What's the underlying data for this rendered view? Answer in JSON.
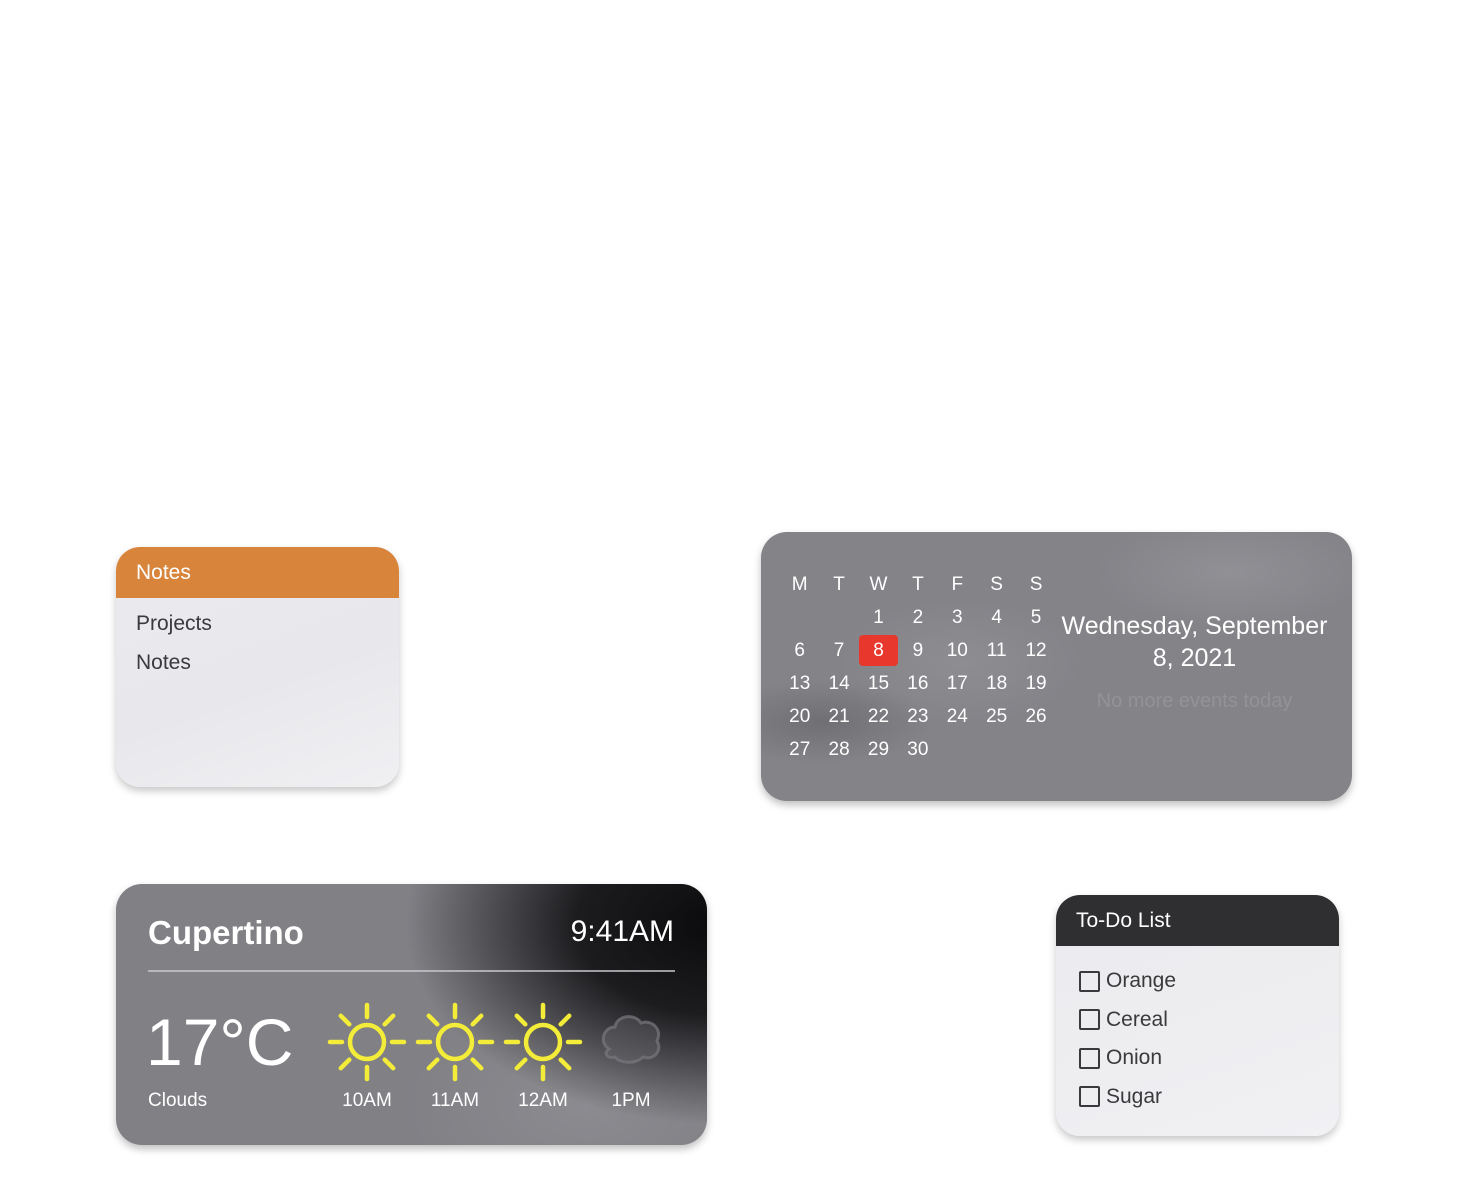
{
  "notes": {
    "title": "Notes",
    "items": [
      "Projects",
      "Notes"
    ],
    "header_color": "#d8843b"
  },
  "calendar": {
    "weekdays": [
      "M",
      "T",
      "W",
      "T",
      "F",
      "S",
      "S"
    ],
    "weeks": [
      [
        "",
        "",
        "1",
        "2",
        "3",
        "4",
        "5"
      ],
      [
        "6",
        "7",
        "8",
        "9",
        "10",
        "11",
        "12"
      ],
      [
        "13",
        "14",
        "15",
        "16",
        "17",
        "18",
        "19"
      ],
      [
        "20",
        "21",
        "22",
        "23",
        "24",
        "25",
        "26"
      ],
      [
        "27",
        "28",
        "29",
        "30",
        "",
        "",
        ""
      ]
    ],
    "today": "8",
    "today_color": "#e8372c",
    "date_title": "Wednesday, September 8, 2021",
    "events_text": "No more events today"
  },
  "weather": {
    "city": "Cupertino",
    "time": "9:41AM",
    "temperature": "17°C",
    "condition": "Clouds",
    "forecast": [
      {
        "time": "10AM",
        "icon": "sun-icon"
      },
      {
        "time": "11AM",
        "icon": "sun-icon"
      },
      {
        "time": "12AM",
        "icon": "sun-icon"
      },
      {
        "time": "1PM",
        "icon": "cloud-icon"
      }
    ],
    "sun_color": "#f3ec38"
  },
  "todo": {
    "title": "To-Do List",
    "header_color": "#2f2f31",
    "items": [
      {
        "label": "Orange",
        "checked": false
      },
      {
        "label": "Cereal",
        "checked": false
      },
      {
        "label": "Onion",
        "checked": false
      },
      {
        "label": "Sugar",
        "checked": false
      }
    ]
  }
}
